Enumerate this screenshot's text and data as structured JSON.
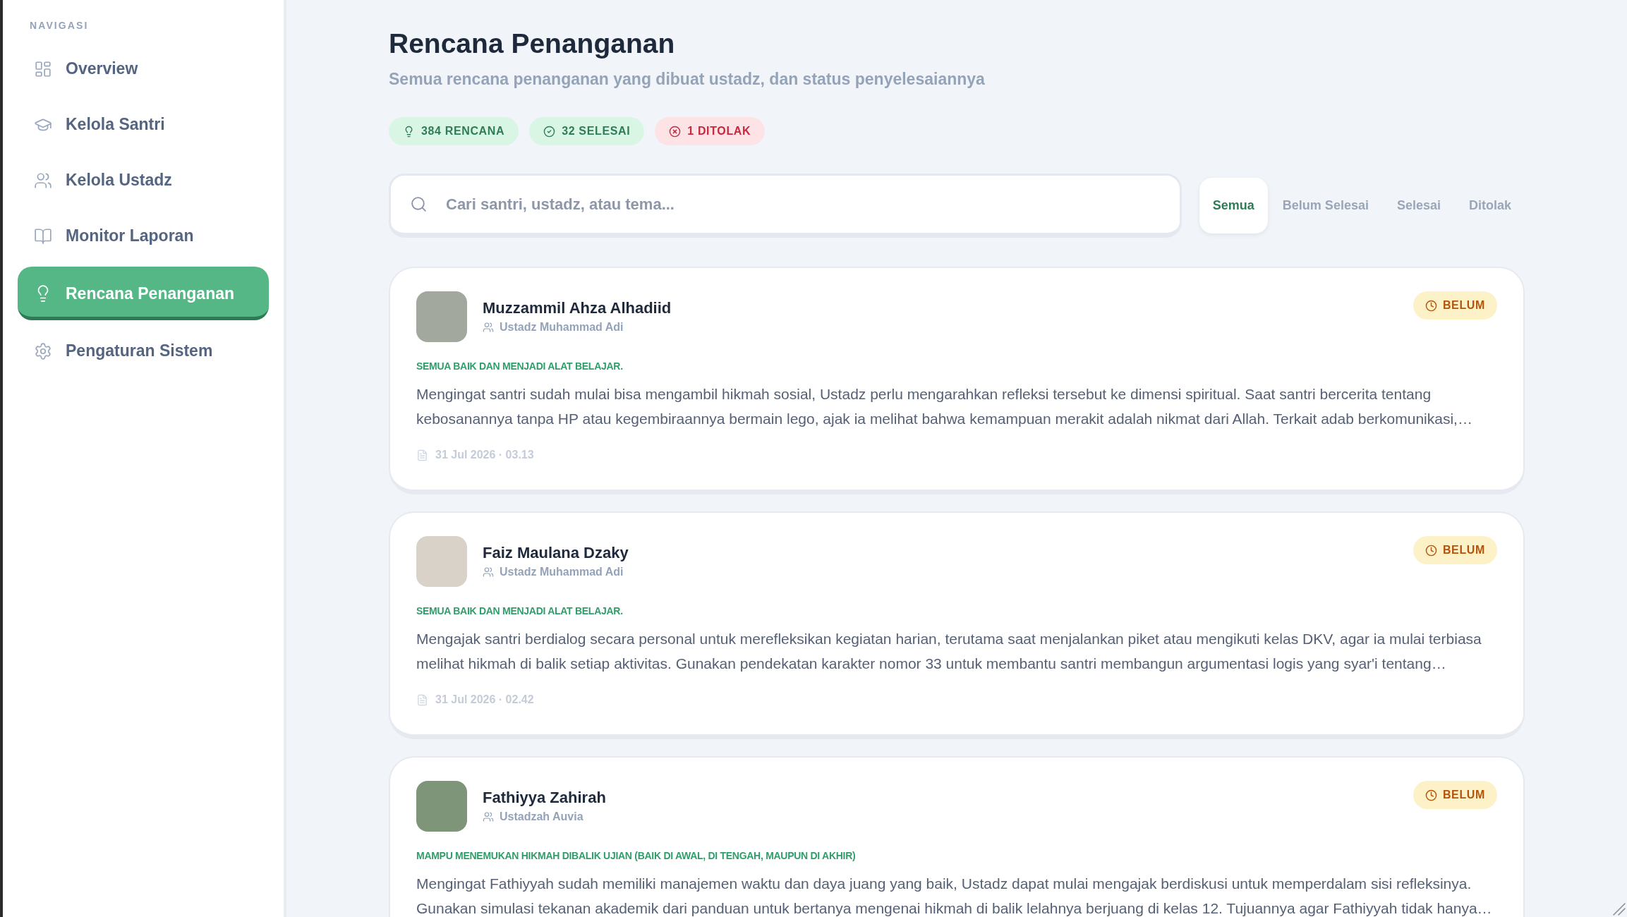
{
  "sidebar": {
    "section_label": "NAVIGASI",
    "items": [
      {
        "label": "Overview",
        "selected": false
      },
      {
        "label": "Kelola Santri",
        "selected": false
      },
      {
        "label": "Kelola Ustadz",
        "selected": false
      },
      {
        "label": "Monitor Laporan",
        "selected": false
      },
      {
        "label": "Rencana Penanganan",
        "selected": true
      },
      {
        "label": "Pengaturan Sistem",
        "selected": false
      }
    ]
  },
  "header": {
    "title": "Rencana Penanganan",
    "subtitle": "Semua rencana penanganan yang dibuat ustadz, dan status penyelesaiannya"
  },
  "summary_badges": [
    {
      "kind": "total",
      "label": "384 RENCANA"
    },
    {
      "kind": "done",
      "label": "32 SELESAI"
    },
    {
      "kind": "rejected",
      "label": "1 DITOLAK"
    }
  ],
  "search": {
    "placeholder": "Cari santri, ustadz, atau tema..."
  },
  "filter_tabs": [
    {
      "label": "Semua",
      "selected": true
    },
    {
      "label": "Belum Selesai",
      "selected": false
    },
    {
      "label": "Selesai",
      "selected": false
    },
    {
      "label": "Ditolak",
      "selected": false
    }
  ],
  "plans": [
    {
      "name": "Muzzammil Ahza Alhadiid",
      "teacher": "Ustadz Muhammad Adi",
      "status": {
        "kind": "pending",
        "label": "BELUM"
      },
      "category": "SEMUA BAIK DAN MENJADI ALAT BELAJAR.",
      "body": "Mengingat santri sudah mulai bisa mengambil hikmah sosial, Ustadz perlu mengarahkan refleksi tersebut ke dimensi spiritual. Saat santri bercerita tentang kebosanannya tanpa HP atau kegembiraannya bermain lego, ajak ia melihat bahwa kemampuan merakit adalah nikmat dari Allah. Terkait adab berkomunikasi,…",
      "date": "31 Jul 2026 · 03.13"
    },
    {
      "name": "Faiz Maulana Dzaky",
      "teacher": "Ustadz Muhammad Adi",
      "status": {
        "kind": "pending",
        "label": "BELUM"
      },
      "category": "SEMUA BAIK DAN MENJADI ALAT BELAJAR.",
      "body": "Mengajak santri berdialog secara personal untuk merefleksikan kegiatan harian, terutama saat menjalankan piket atau mengikuti kelas DKV, agar ia mulai terbiasa melihat hikmah di balik setiap aktivitas. Gunakan pendekatan karakter nomor 33 untuk membantu santri membangun argumentasi logis yang syar'i tentang…",
      "date": "31 Jul 2026 · 02.42"
    },
    {
      "name": "Fathiyya Zahirah",
      "teacher": "Ustadzah Auvia",
      "status": {
        "kind": "pending",
        "label": "BELUM"
      },
      "category": "MAMPU MENEMUKAN HIKMAH DIBALIK UJIAN (BAIK DI AWAL, DI TENGAH, MAUPUN DI AKHIR)",
      "body": "Mengingat Fathiyyah sudah memiliki manajemen waktu dan daya juang yang baik, Ustadz dapat mulai mengajak berdiskusi untuk memperdalam sisi refleksinya. Gunakan simulasi tekanan akademik dari panduan untuk bertanya mengenai hikmah di balik lelahnya berjuang di kelas 12. Tujuannya agar Fathiyyah tidak hanya…"
    }
  ]
}
